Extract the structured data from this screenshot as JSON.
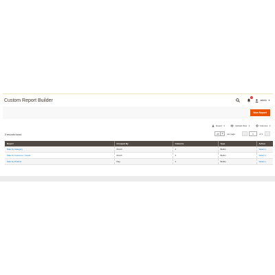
{
  "header": {
    "title": "Custom Report Builder",
    "notifications_count": "1",
    "user_name": "admin",
    "icons": {
      "search": "search-icon",
      "bell": "bell-icon",
      "user": "user-icon"
    }
  },
  "actions": {
    "new_report_label": "New Report",
    "accent_color": "#eb5202"
  },
  "grid_controls": {
    "export_label": "Export",
    "view_label": "Default View",
    "columns_label": "Columns"
  },
  "records_found": "3 records found",
  "pager": {
    "per_page_value": "20",
    "per_page_label": "per page",
    "current_page": "1",
    "of_pages": "of 1"
  },
  "table": {
    "columns": [
      "Report",
      "Grouped By",
      "Columns",
      "Type",
      "Action"
    ],
    "rows": [
      {
        "report": "Sale by Category",
        "grouped_by": "Month",
        "columns": "4",
        "type": "Builtin",
        "action": "Select"
      },
      {
        "report": "Sale by Customer / Guest",
        "grouped_by": "Month",
        "columns": "3",
        "type": "Builtin",
        "action": "Select"
      },
      {
        "report": "Sale by Product",
        "grouped_by": "Day",
        "columns": "4",
        "type": "Builtin",
        "action": "Select"
      }
    ]
  }
}
